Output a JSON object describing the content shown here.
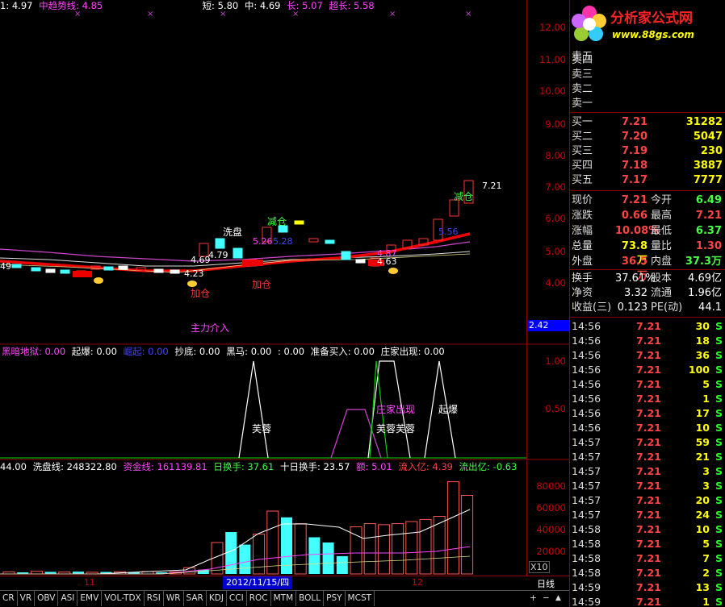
{
  "main_legend": {
    "items": [
      {
        "text": "1: 4.97",
        "color": "#ffffff"
      },
      {
        "text": "中趋势线: 4.85",
        "color": "#ff44ff"
      },
      {
        "text": "短: 5.80",
        "color": "#ffffff"
      },
      {
        "text": "中: 4.69",
        "color": "#ffffff"
      },
      {
        "text": "长: 5.07",
        "color": "#ff44ff"
      },
      {
        "text": "超长: 5.58",
        "color": "#ff44ff"
      }
    ]
  },
  "price_axis": [
    "12.00",
    "11.00",
    "10.00",
    "9.00",
    "8.00",
    "7.00",
    "6.00",
    "5.00",
    "4.00"
  ],
  "price_axis_box": "2.42",
  "chart_labels": {
    "xipan": "洗盘",
    "jiancang1": "减仓",
    "jiancang2": "减仓",
    "jiacang1": "加仓",
    "jiacang2": "加仓",
    "zhuli": "主力介入",
    "v479": "4.79",
    "v469": "4.69",
    "v423": "4.23",
    "v526": "5.26",
    "v528": "5.28",
    "v487": "4.87",
    "v463": "4.63",
    "v556": "5.56",
    "v721": "7.21",
    "v49": "49"
  },
  "indicator_legend": {
    "items": [
      {
        "text": "黑暗地狱: 0.00",
        "color": "#ff44ff"
      },
      {
        "text": "起爆: 0.00",
        "color": "#ffffff"
      },
      {
        "text": "崛起: 0.00",
        "color": "#4444ff"
      },
      {
        "text": "抄底: 0.00",
        "color": "#ffffff"
      },
      {
        "text": "黑马: 0.00",
        "color": "#ffffff"
      },
      {
        "text": ": 0.00",
        "color": "#ffffff"
      },
      {
        "text": "准备买入: 0.00",
        "color": "#ffffff"
      },
      {
        "text": "庄家出现: 0.00",
        "color": "#ffffff"
      }
    ],
    "axis": [
      "1.00",
      "0.50"
    ],
    "labels": {
      "furong1": "芙蓉",
      "furong2": "芙蓉芙蓉",
      "zhuangjia": "庄家出现",
      "qibao": "起爆"
    }
  },
  "volume_legend": {
    "items": [
      {
        "text": "44.00",
        "color": "#ffffff"
      },
      {
        "text": "洗盘线: 248322.80",
        "color": "#ffffff"
      },
      {
        "text": "资金线: 161139.81",
        "color": "#ff44ff"
      },
      {
        "text": "日换手: 37.61",
        "color": "#44ff44"
      },
      {
        "text": "十日换手: 23.57",
        "color": "#ffffff"
      },
      {
        "text": "额: 5.01",
        "color": "#ff44ff"
      },
      {
        "text": "流入亿: 4.39",
        "color": "#ff4444"
      },
      {
        "text": "流出亿: -0.63",
        "color": "#44ff44"
      }
    ],
    "axis": [
      "80000",
      "60000",
      "40000",
      "20000"
    ],
    "unit": "X10"
  },
  "date_axis": {
    "m11": "11",
    "date_box": "2012/11/15/四",
    "m12": "12",
    "period": "日线"
  },
  "tabs": [
    "CR",
    "VR",
    "OBV",
    "ASI",
    "EMV",
    "VOL-TDX",
    "RSI",
    "WR",
    "SAR",
    "KDJ",
    "CCI",
    "ROC",
    "MTM",
    "BOLL",
    "PSY",
    "MCST"
  ],
  "tab_icons": {
    "plus": "+",
    "minus": "−",
    "up": "▲"
  },
  "logo": {
    "title": "分析家公式网",
    "url": "www.88gs.com"
  },
  "sell_orders": [
    {
      "label": "卖五"
    },
    {
      "label": "卖四"
    },
    {
      "label": "卖三"
    },
    {
      "label": "卖二"
    },
    {
      "label": "卖一"
    }
  ],
  "buy_orders": [
    {
      "label": "买一",
      "price": "7.21",
      "volume": "31282"
    },
    {
      "label": "买二",
      "price": "7.20",
      "volume": "5047"
    },
    {
      "label": "买三",
      "price": "7.19",
      "volume": "230"
    },
    {
      "label": "买四",
      "price": "7.18",
      "volume": "3887"
    },
    {
      "label": "买五",
      "price": "7.17",
      "volume": "7777"
    }
  ],
  "stats": [
    {
      "l1": "现价",
      "v1": "7.21",
      "c1": "#ff4444",
      "l2": "今开",
      "v2": "6.49",
      "c2": "#44ff44"
    },
    {
      "l1": "涨跌",
      "v1": "0.66",
      "c1": "#ff4444",
      "l2": "最高",
      "v2": "7.21",
      "c2": "#ff4444"
    },
    {
      "l1": "涨幅",
      "v1": "10.08%",
      "c1": "#ff4444",
      "l2": "最低",
      "v2": "6.37",
      "c2": "#44ff44"
    },
    {
      "l1": "总量",
      "v1": "73.8万",
      "c1": "#ffff00",
      "l2": "量比",
      "v2": "1.30",
      "c2": "#ff4444"
    },
    {
      "l1": "外盘",
      "v1": "36.5万",
      "c1": "#ff4444",
      "l2": "内盘",
      "v2": "37.3万",
      "c2": "#44ff44"
    }
  ],
  "fundamentals": [
    {
      "l1": "换手",
      "v1": "37.61%",
      "l2": "股本",
      "v2": "4.69亿"
    },
    {
      "l1": "净资",
      "v1": "3.32",
      "l2": "流通",
      "v2": "1.96亿"
    },
    {
      "l1": "收益(三)",
      "v1": "0.123",
      "l2": "PE(动)",
      "v2": "44.1"
    }
  ],
  "ticks": [
    {
      "time": "14:56",
      "price": "7.21",
      "vol": "30",
      "side": "S"
    },
    {
      "time": "14:56",
      "price": "7.21",
      "vol": "18",
      "side": "S"
    },
    {
      "time": "14:56",
      "price": "7.21",
      "vol": "36",
      "side": "S"
    },
    {
      "time": "14:56",
      "price": "7.21",
      "vol": "100",
      "side": "S"
    },
    {
      "time": "14:56",
      "price": "7.21",
      "vol": "5",
      "side": "S"
    },
    {
      "time": "14:56",
      "price": "7.21",
      "vol": "1",
      "side": "S"
    },
    {
      "time": "14:56",
      "price": "7.21",
      "vol": "17",
      "side": "S"
    },
    {
      "time": "14:56",
      "price": "7.21",
      "vol": "10",
      "side": "S"
    },
    {
      "time": "14:57",
      "price": "7.21",
      "vol": "59",
      "side": "S"
    },
    {
      "time": "14:57",
      "price": "7.21",
      "vol": "21",
      "side": "S"
    },
    {
      "time": "14:57",
      "price": "7.21",
      "vol": "3",
      "side": "S"
    },
    {
      "time": "14:57",
      "price": "7.21",
      "vol": "3",
      "side": "S"
    },
    {
      "time": "14:57",
      "price": "7.21",
      "vol": "20",
      "side": "S"
    },
    {
      "time": "14:57",
      "price": "7.21",
      "vol": "24",
      "side": "S"
    },
    {
      "time": "14:58",
      "price": "7.21",
      "vol": "10",
      "side": "S"
    },
    {
      "time": "14:58",
      "price": "7.21",
      "vol": "5",
      "side": "S"
    },
    {
      "time": "14:58",
      "price": "7.21",
      "vol": "7",
      "side": "S"
    },
    {
      "time": "14:58",
      "price": "7.21",
      "vol": "2",
      "side": "S"
    },
    {
      "time": "14:59",
      "price": "7.21",
      "vol": "13",
      "side": "S"
    },
    {
      "time": "14:59",
      "price": "7.21",
      "vol": "1",
      "side": "S"
    }
  ],
  "volume_bars": [
    {
      "v": 2000,
      "up": true
    },
    {
      "v": 1500,
      "up": false
    },
    {
      "v": 2500,
      "up": true
    },
    {
      "v": 2000,
      "up": false
    },
    {
      "v": 1800,
      "up": true
    },
    {
      "v": 2200,
      "up": false
    },
    {
      "v": 1600,
      "up": true
    },
    {
      "v": 1900,
      "up": false
    },
    {
      "v": 2100,
      "up": true
    },
    {
      "v": 1700,
      "up": false
    },
    {
      "v": 2300,
      "up": true
    },
    {
      "v": 1500,
      "up": false
    },
    {
      "v": 2000,
      "up": true
    },
    {
      "v": 6000,
      "up": true
    },
    {
      "v": 4000,
      "up": false
    },
    {
      "v": 30000,
      "up": true
    },
    {
      "v": 40000,
      "up": false
    },
    {
      "v": 28000,
      "up": false
    },
    {
      "v": 38000,
      "up": true
    },
    {
      "v": 60000,
      "up": true
    },
    {
      "v": 54000,
      "up": false
    },
    {
      "v": 48000,
      "up": true
    },
    {
      "v": 35000,
      "up": false
    },
    {
      "v": 30000,
      "up": false
    },
    {
      "v": 17000,
      "up": false
    },
    {
      "v": 45000,
      "up": true
    },
    {
      "v": 48000,
      "up": true
    },
    {
      "v": 47000,
      "up": true
    },
    {
      "v": 48000,
      "up": true
    },
    {
      "v": 50000,
      "up": true
    },
    {
      "v": 52000,
      "up": true
    },
    {
      "v": 55000,
      "up": true
    },
    {
      "v": 88000,
      "up": true
    },
    {
      "v": 75000,
      "up": true
    }
  ]
}
